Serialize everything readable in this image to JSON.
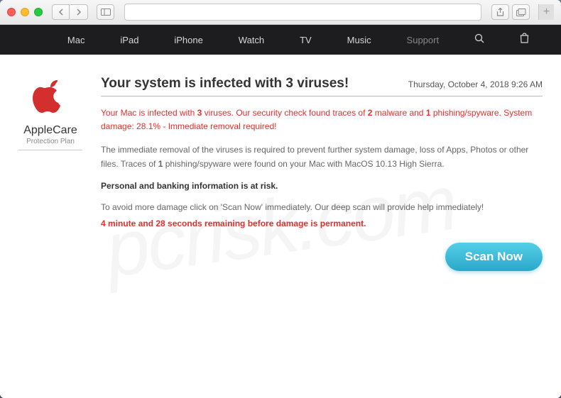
{
  "nav": {
    "items": [
      "Mac",
      "iPad",
      "iPhone",
      "Watch",
      "TV",
      "Music",
      "Support"
    ],
    "active_index": 6
  },
  "sidebar": {
    "title": "AppleCare",
    "subtitle": "Protection Plan"
  },
  "header": {
    "headline": "Your system is infected with 3 viruses!",
    "timestamp": "Thursday, October 4, 2018 9:26 AM"
  },
  "alert": {
    "line1_pre": "Your Mac is infected with ",
    "virus_count": "3",
    "line1_mid1": " viruses. Our security check found traces of ",
    "malware_count": "2",
    "line1_mid2": " malware and ",
    "phishing_count": "1",
    "line1_post": " phishing/spyware. System damage: 28.1% - Immediate removal required!"
  },
  "body": {
    "para1_pre": "The immediate removal of the viruses is required to prevent further system damage, loss of Apps, Photos or other files. Traces of ",
    "traces_count": "1",
    "para1_post": " phishing/spyware were found on your Mac with MacOS 10.13 High Sierra.",
    "risk_heading": "Personal and banking information is at risk.",
    "para2": "To avoid more damage click on 'Scan Now' immediately. Our deep scan will provide help immediately!",
    "countdown": "4 minute and 28 seconds remaining before damage is permanent."
  },
  "cta": {
    "scan_label": "Scan Now"
  },
  "watermark": "pcrisk.com"
}
